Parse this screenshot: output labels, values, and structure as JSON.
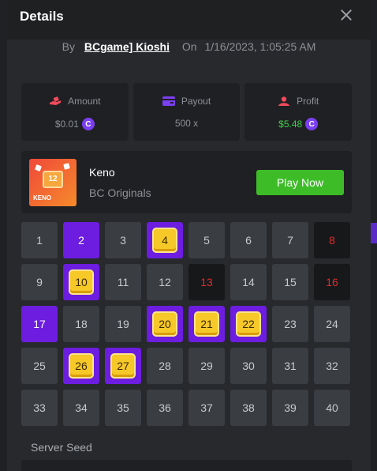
{
  "header": {
    "title": "Details",
    "close_icon": "close-icon"
  },
  "bet": {
    "by_label": "By",
    "user": "BCgame] Kioshi",
    "on_label": "On",
    "date": "1/16/2023, 1:05:25 AM"
  },
  "stats": [
    {
      "label": "Amount",
      "value": "$0.01",
      "icon": "hand-coin-icon",
      "coin": "bc-coin-icon",
      "color": "#8d9096"
    },
    {
      "label": "Payout",
      "value": "500 x",
      "icon": "card-icon",
      "color": "#8d9096"
    },
    {
      "label": "Profit",
      "value": "$5.48",
      "icon": "user-profit-icon",
      "coin": "bc-coin-icon",
      "color": "#3fd04a"
    }
  ],
  "game": {
    "name": "Keno",
    "provider": "BC Originals",
    "play_label": "Play Now",
    "thumb_label": "KENO",
    "thumb_number": "12"
  },
  "grid": {
    "cells": [
      {
        "n": "1",
        "s": "none"
      },
      {
        "n": "2",
        "s": "picked"
      },
      {
        "n": "3",
        "s": "none"
      },
      {
        "n": "4",
        "s": "hit"
      },
      {
        "n": "5",
        "s": "none"
      },
      {
        "n": "6",
        "s": "none"
      },
      {
        "n": "7",
        "s": "none"
      },
      {
        "n": "8",
        "s": "miss"
      },
      {
        "n": "9",
        "s": "none"
      },
      {
        "n": "10",
        "s": "hit"
      },
      {
        "n": "11",
        "s": "none"
      },
      {
        "n": "12",
        "s": "none"
      },
      {
        "n": "13",
        "s": "miss"
      },
      {
        "n": "14",
        "s": "none"
      },
      {
        "n": "15",
        "s": "none"
      },
      {
        "n": "16",
        "s": "miss"
      },
      {
        "n": "17",
        "s": "picked"
      },
      {
        "n": "18",
        "s": "none"
      },
      {
        "n": "19",
        "s": "none"
      },
      {
        "n": "20",
        "s": "hit"
      },
      {
        "n": "21",
        "s": "hit"
      },
      {
        "n": "22",
        "s": "hit"
      },
      {
        "n": "23",
        "s": "none"
      },
      {
        "n": "24",
        "s": "none"
      },
      {
        "n": "25",
        "s": "none"
      },
      {
        "n": "26",
        "s": "hit"
      },
      {
        "n": "27",
        "s": "hit"
      },
      {
        "n": "28",
        "s": "none"
      },
      {
        "n": "29",
        "s": "none"
      },
      {
        "n": "30",
        "s": "none"
      },
      {
        "n": "31",
        "s": "none"
      },
      {
        "n": "32",
        "s": "none"
      },
      {
        "n": "33",
        "s": "none"
      },
      {
        "n": "34",
        "s": "none"
      },
      {
        "n": "35",
        "s": "none"
      },
      {
        "n": "36",
        "s": "none"
      },
      {
        "n": "37",
        "s": "none"
      },
      {
        "n": "38",
        "s": "none"
      },
      {
        "n": "39",
        "s": "none"
      },
      {
        "n": "40",
        "s": "none"
      }
    ]
  },
  "server_seed": {
    "label": "Server Seed"
  },
  "colors": {
    "accent_purple": "#6d1de0",
    "play_green": "#3dbc28",
    "profit_green": "#3fd04a",
    "miss_red": "#e02c2c",
    "hit_gold": "#f6c828"
  }
}
